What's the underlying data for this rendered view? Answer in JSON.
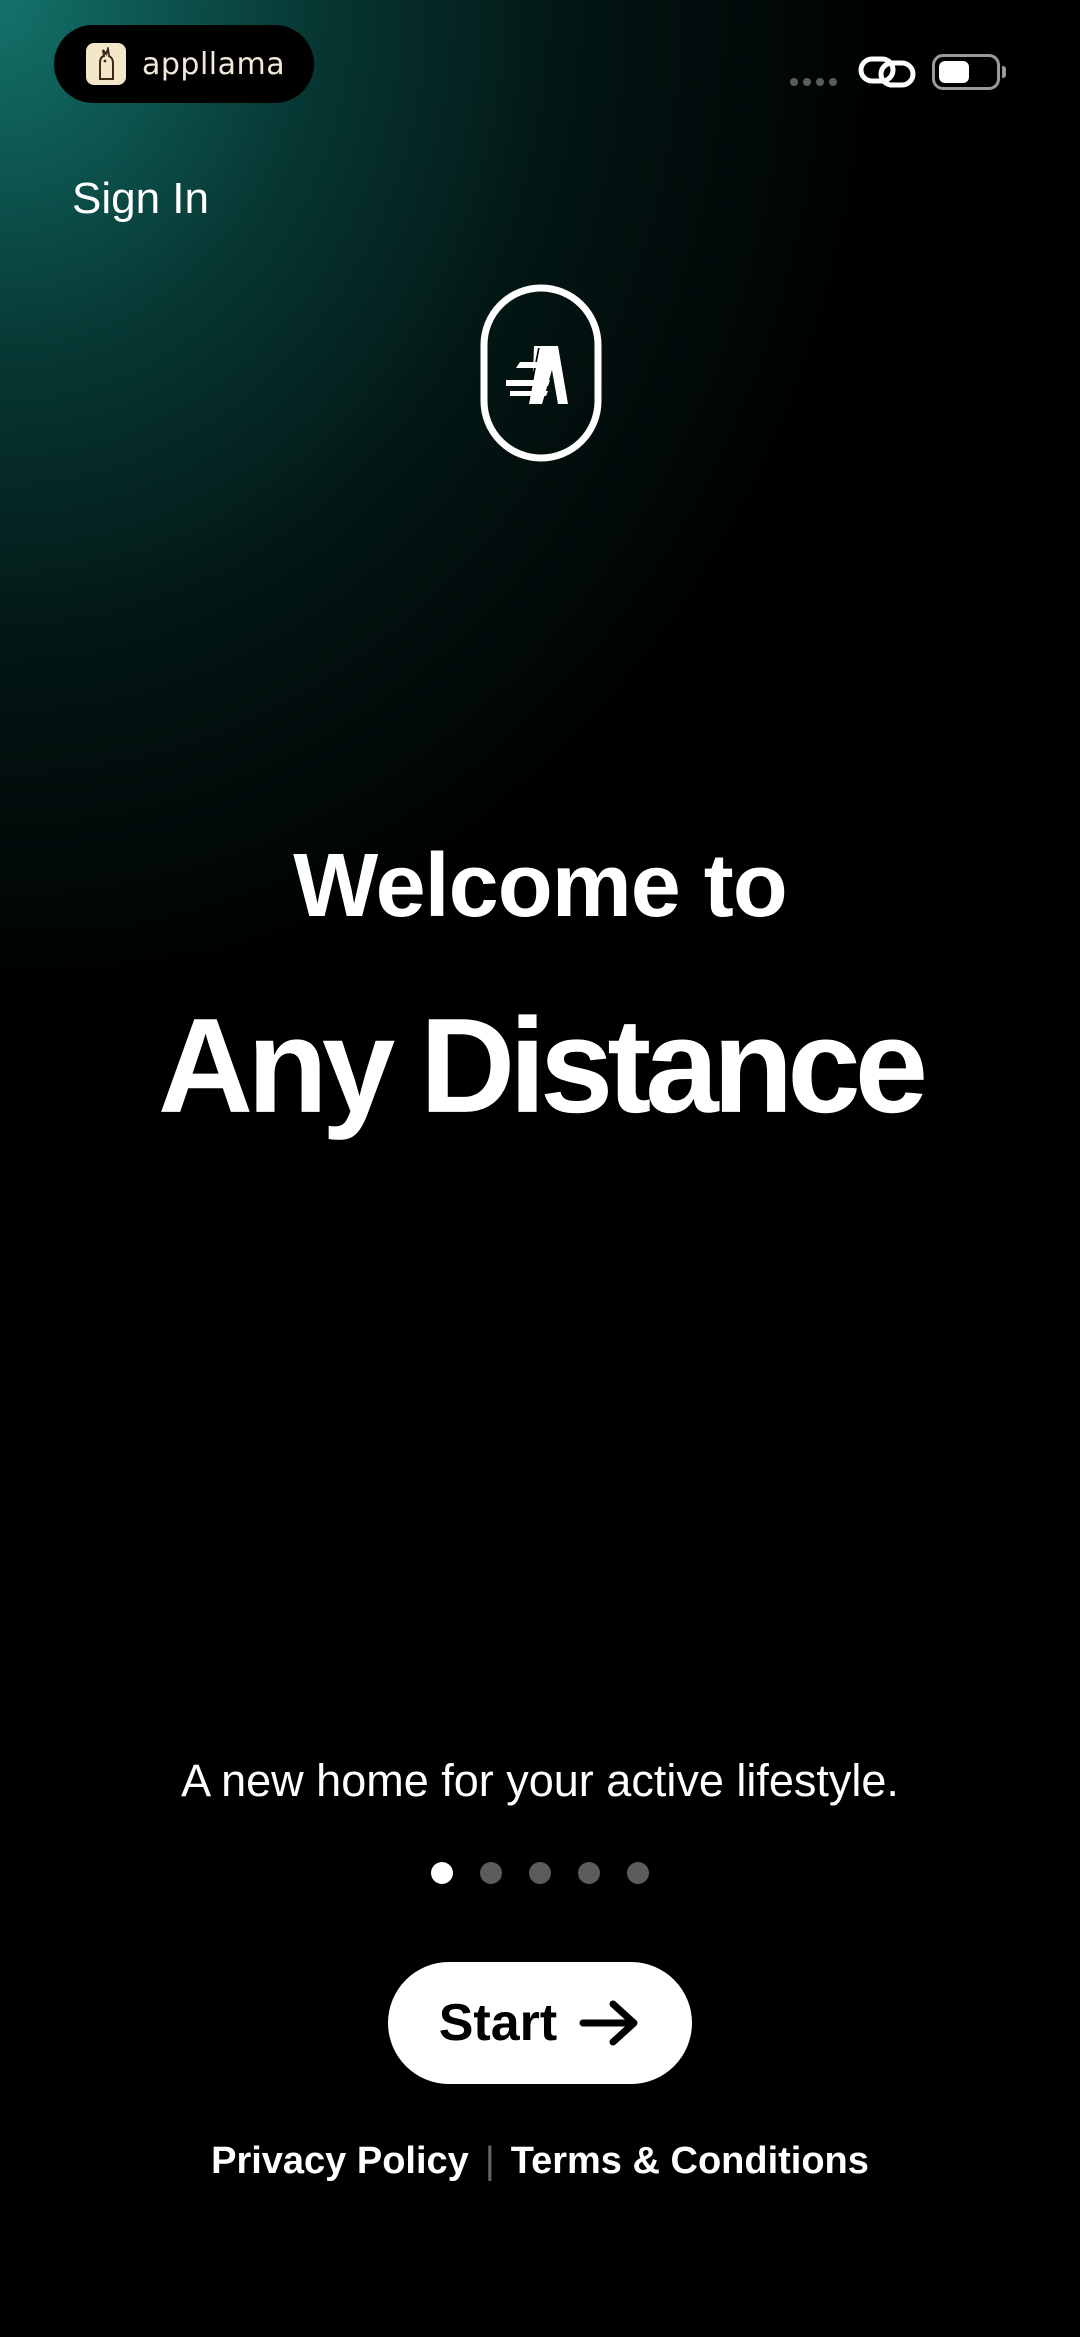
{
  "status_bar": {
    "brand_name": "appllama",
    "brand_icon": "llama-icon",
    "link_icon": "link-icon",
    "battery_level": 0.55
  },
  "header": {
    "sign_in_label": "Sign In"
  },
  "logo": {
    "icon": "any-distance-logo"
  },
  "hero": {
    "welcome": "Welcome to",
    "app_name": "Any Distance"
  },
  "onboarding": {
    "tagline": "A new home for your active lifestyle.",
    "page_count": 5,
    "current_page": 1
  },
  "actions": {
    "start_label": "Start",
    "start_icon": "arrow-right-icon"
  },
  "footer": {
    "privacy_label": "Privacy Policy",
    "separator": "|",
    "terms_label": "Terms & Conditions"
  },
  "colors": {
    "background": "#000000",
    "gradient_accent": "#147870",
    "text": "#ffffff",
    "inactive_dot": "#5c5c5c"
  }
}
